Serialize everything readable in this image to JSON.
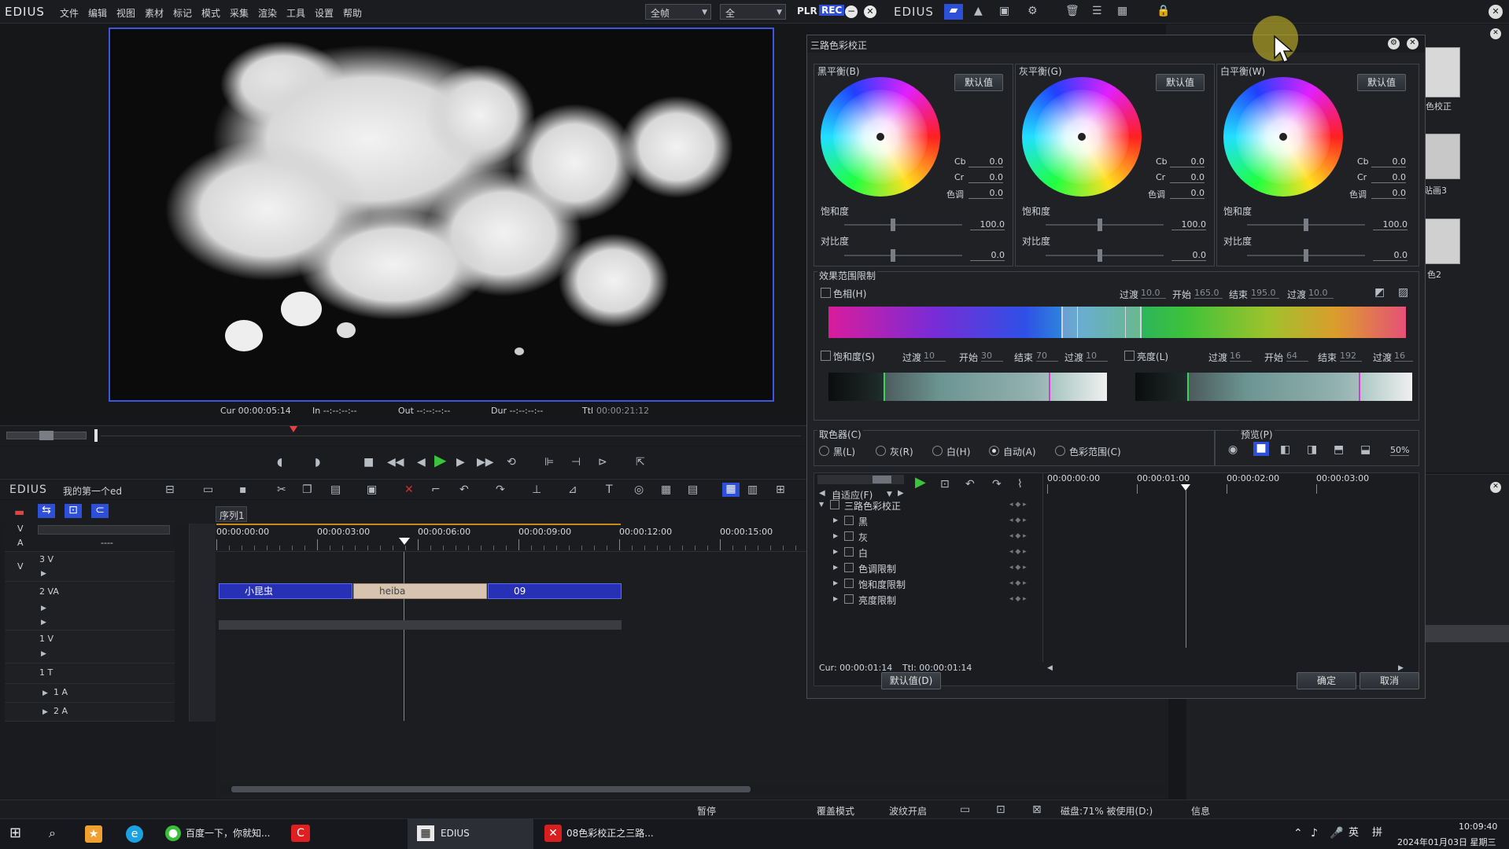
{
  "menubar": {
    "app_logo": "EDIUS",
    "items": [
      "文件",
      "编辑",
      "视图",
      "素材",
      "标记",
      "模式",
      "采集",
      "渲染",
      "工具",
      "设置",
      "帮助"
    ],
    "select1": "全帧",
    "select2": "全",
    "plr": "PLR",
    "rec": "REC",
    "right_logo": "EDIUS"
  },
  "preview": {
    "cur": "Cur 00:00:05:14",
    "in": "In --:--:--:--",
    "out": "Out --:--:--:--",
    "dur": "Dur --:--:--:--",
    "ttl_label": "Ttl",
    "ttl_value": "00:00:21:12"
  },
  "timeline_header": {
    "logo": "EDIUS",
    "project": "我的第一个ed",
    "sequence_tab": "序列1",
    "ruler": [
      "00:00:00:00",
      "00:00:03:00",
      "00:00:06:00",
      "00:00:09:00",
      "00:00:12:00",
      "00:00:15:00"
    ]
  },
  "tracks": {
    "v_label": "V",
    "a_label": "A",
    "a_value": "----",
    "v3": "3 V",
    "va2": "2 VA",
    "v1": "1 V",
    "t1": "1 T",
    "a1": "1 A",
    "a2": "2 A",
    "clips": [
      "小昆虫",
      "heiba",
      "09"
    ]
  },
  "dialog": {
    "title": "三路色彩校正",
    "wheels": [
      {
        "title": "黑平衡(B)",
        "default_btn": "默认值",
        "cb_label": "Cb",
        "cb": "0.0",
        "cr_label": "Cr",
        "cr": "0.0",
        "hue_label": "色调",
        "hue": "0.0",
        "sat_label": "饱和度",
        "sat": "100.0",
        "con_label": "对比度",
        "con": "0.0"
      },
      {
        "title": "灰平衡(G)",
        "default_btn": "默认值",
        "cb_label": "Cb",
        "cb": "0.0",
        "cr_label": "Cr",
        "cr": "0.0",
        "hue_label": "色调",
        "hue": "0.0",
        "sat_label": "饱和度",
        "sat": "100.0",
        "con_label": "对比度",
        "con": "0.0"
      },
      {
        "title": "白平衡(W)",
        "default_btn": "默认值",
        "cb_label": "Cb",
        "cb": "0.0",
        "cr_label": "Cr",
        "cr": "0.0",
        "hue_label": "色调",
        "hue": "0.0",
        "sat_label": "饱和度",
        "sat": "100.0",
        "con_label": "对比度",
        "con": "0.0"
      }
    ],
    "range": {
      "title": "效果范围限制",
      "hue_label": "色相(H)",
      "hue_trans1_label": "过渡",
      "hue_trans1": "10.0",
      "hue_start_label": "开始",
      "hue_start": "165.0",
      "hue_end_label": "结束",
      "hue_end": "195.0",
      "hue_trans2_label": "过渡",
      "hue_trans2": "10.0",
      "sat_label": "饱和度(S)",
      "sat_trans1_label": "过渡",
      "sat_trans1": "10",
      "sat_start_label": "开始",
      "sat_start": "30",
      "sat_end_label": "结束",
      "sat_end": "70",
      "sat_trans2_label": "过渡",
      "sat_trans2": "10",
      "lum_label": "亮度(L)",
      "lum_trans1_label": "过渡",
      "lum_trans1": "16",
      "lum_start_label": "开始",
      "lum_start": "64",
      "lum_end_label": "结束",
      "lum_end": "192",
      "lum_trans2_label": "过渡",
      "lum_trans2": "16"
    },
    "picker": {
      "title": "取色器(C)",
      "options": [
        "黑(L)",
        "灰(R)",
        "白(H)",
        "自动(A)",
        "色彩范围(C)"
      ],
      "selected": "自动(A)"
    },
    "preview": {
      "title": "预览(P)",
      "percent": "50%"
    },
    "keyframe": {
      "fit": "自适应(F)",
      "ruler": [
        "00:00:00:00",
        "00:00:01:00",
        "00:00:02:00",
        "00:00:03:00"
      ],
      "tree": [
        "三路色彩校正",
        "黑",
        "灰",
        "白",
        "色调限制",
        "饱和度限制",
        "亮度限制"
      ],
      "cur": "Cur: 00:00:01:14",
      "ttl": "Ttl: 00:00:01:14"
    },
    "default_btn": "默认值(D)",
    "ok": "确定",
    "cancel": "取消"
  },
  "right_panel": {
    "thumb1": "色校正",
    "thumb2": "贴画3",
    "thumb3": "色2"
  },
  "statusbar": {
    "paused": "暂停",
    "overwrite": "覆盖模式",
    "ripple": "波纹开启",
    "disk": "磁盘:71% 被使用(D:)",
    "info": "信息"
  },
  "taskbar": {
    "tasks": [
      "百度一下，你就知...",
      "EDIUS",
      "08色彩校正之三路..."
    ],
    "ime": "英",
    "ime2": "拼",
    "time": "10:09:40",
    "date": "2024年01月03日 星期三"
  },
  "colors": {
    "clip_blue": "#2831b5",
    "accent_blue": "#3f6fe8",
    "play_green": "#3cc43c"
  }
}
